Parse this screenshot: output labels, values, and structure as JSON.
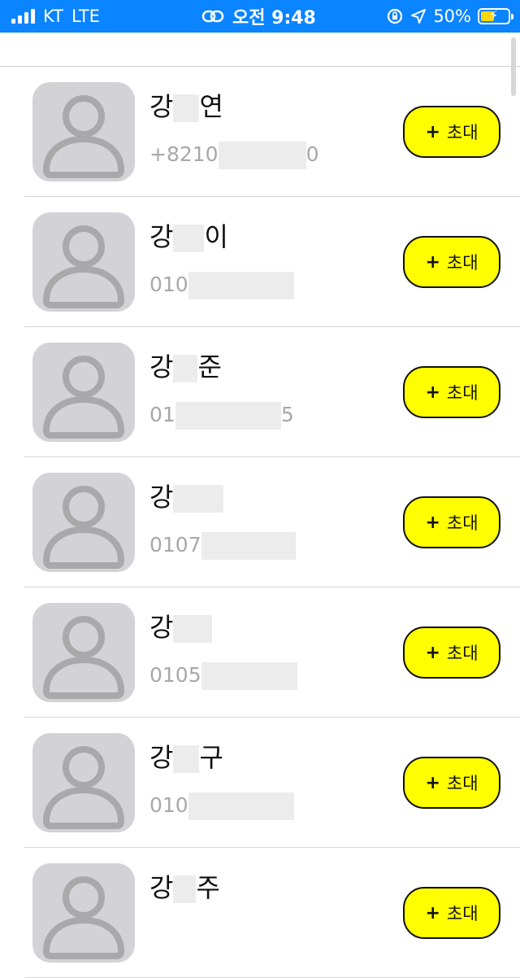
{
  "status_bar": {
    "carrier": "KT",
    "network": "LTE",
    "link_icon": "link-icon",
    "time": "오전 9:48",
    "battery_percent": "50%",
    "battery_level": 0.5,
    "colors": {
      "background": "#0a84ff",
      "battery_fill": "#ffd60a"
    }
  },
  "invite_button": {
    "plus": "+",
    "label": "초대",
    "color": "#ffff00"
  },
  "contacts": [
    {
      "name_first": "강",
      "name_last": "연",
      "phone_start": "+8210",
      "phone_end": "0"
    },
    {
      "name_first": "강",
      "name_last": "이",
      "phone_start": "010",
      "phone_end": ""
    },
    {
      "name_first": "강",
      "name_last": "준",
      "phone_start": "01",
      "phone_end": "5"
    },
    {
      "name_first": "강",
      "name_last": "",
      "phone_start": "0107",
      "phone_end": ""
    },
    {
      "name_first": "강",
      "name_last": "",
      "phone_start": "0105",
      "phone_end": ""
    },
    {
      "name_first": "강",
      "name_last": "구",
      "phone_start": "010",
      "phone_end": ""
    },
    {
      "name_first": "강",
      "name_last": "주",
      "phone_start": "",
      "phone_end": ""
    }
  ]
}
